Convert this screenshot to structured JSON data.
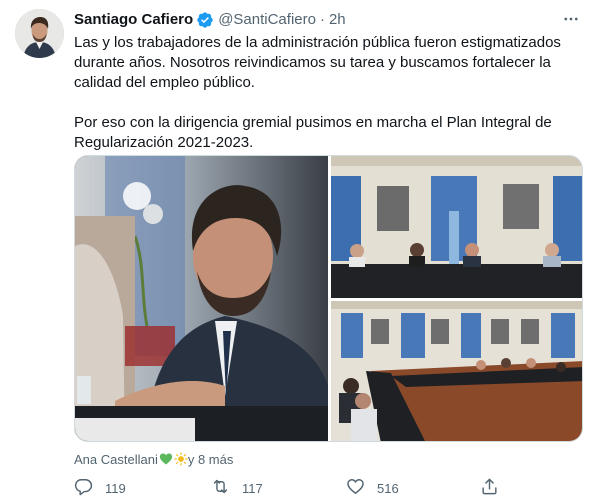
{
  "tweet": {
    "author_name": "Santiago Cafiero",
    "handle": "@SantiCafiero",
    "separator": "·",
    "time": "2h",
    "text": "Las y los trabajadores de la administración pública fueron estigmatizados durante años. Nosotros reivindicamos su tarea y buscamos fortalecer la calidad del empleo público.\n\nPor eso con la dirigencia gremial pusimos en marcha el Plan Integral de Regularización 2021-2023.",
    "tagged_prefix": "Ana Castellani",
    "tagged_suffix": " y 8 más",
    "replies": "119",
    "retweets": "117",
    "likes": "516"
  },
  "colors": {
    "verified": "#1d9bf0",
    "secondary_text": "#536471",
    "primary_text": "#0f1419",
    "border": "#cfd9de"
  },
  "icons": [
    "verified-badge-icon",
    "more-icon",
    "reply-icon",
    "retweet-icon",
    "like-icon",
    "share-icon",
    "green-heart-emoji",
    "sun-emoji"
  ]
}
